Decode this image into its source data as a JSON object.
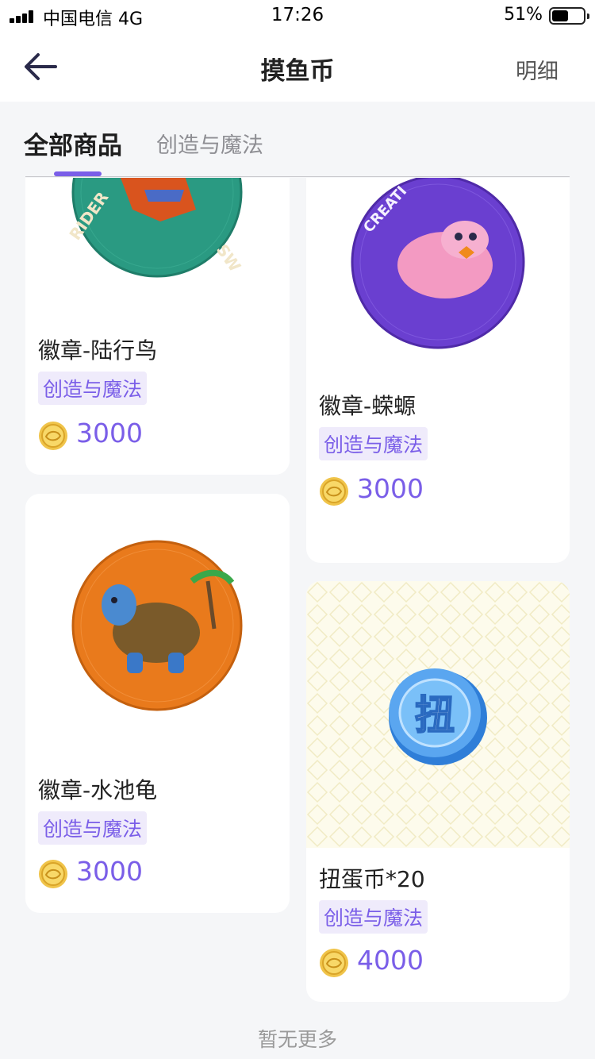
{
  "status": {
    "carrier": "中国电信 4G",
    "time": "17:26",
    "battery": "51%"
  },
  "nav": {
    "title": "摸鱼币",
    "right": "明细"
  },
  "tabs": [
    "全部商品",
    "创造与魔法"
  ],
  "products": [
    {
      "name": "徽章-陆行鸟",
      "tag": "创造与魔法",
      "price": "3000",
      "badge_color": "#2a9a82"
    },
    {
      "name": "徽章-蝾螈",
      "tag": "创造与魔法",
      "price": "3000",
      "badge_color": "#6a3fd0"
    },
    {
      "name": "徽章-水池龟",
      "tag": "创造与魔法",
      "price": "3000",
      "badge_color": "#e97a1c"
    },
    {
      "name": "扭蛋币*20",
      "tag": "创造与魔法",
      "price": "4000",
      "coin_text": "扭"
    }
  ],
  "footer": "暂无更多",
  "colors": {
    "accent": "#7a5ee8",
    "tag_bg": "#efebfb",
    "page_bg": "#f5f6f8"
  }
}
